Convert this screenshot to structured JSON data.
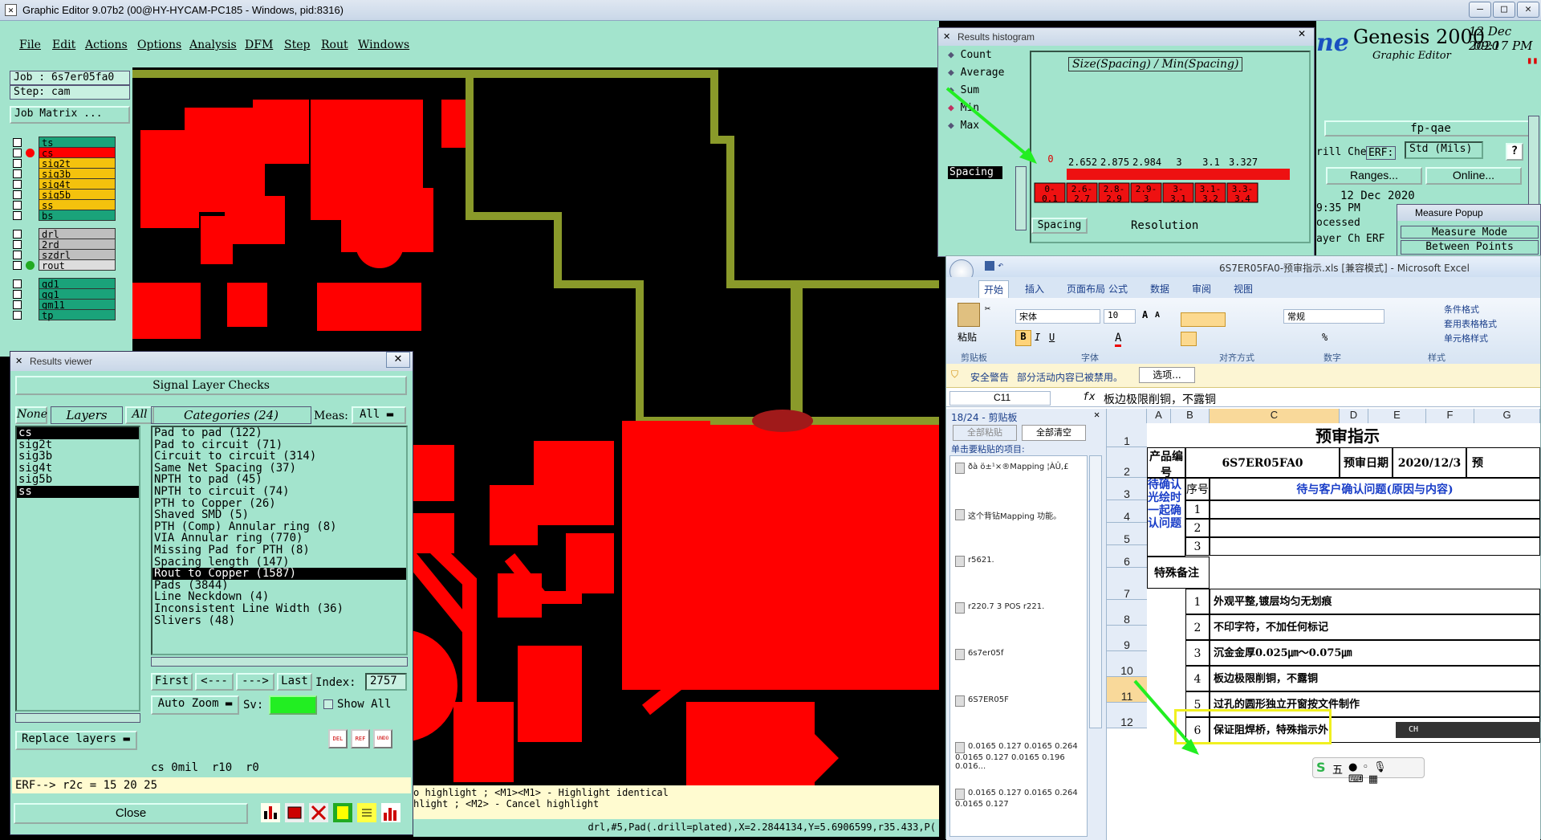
{
  "window": {
    "title": "Graphic Editor 9.07b2 (00@HY-HYCAM-PC185 - Windows, pid:8316)"
  },
  "menu": [
    "File",
    "Edit",
    "Actions",
    "Options",
    "Analysis",
    "DFM",
    "Step",
    "Rout",
    "Windows"
  ],
  "job": {
    "job_label": "Job : 6s7er05fa0",
    "step_label": "Step: cam",
    "matrix_button": "Job Matrix ..."
  },
  "layers": [
    {
      "name": "ts",
      "color": "#1aa37a",
      "dot": ""
    },
    {
      "name": "cs",
      "color": "#ff0000",
      "dot": "#ff0000"
    },
    {
      "name": "sig2t",
      "color": "#f4c20d",
      "dot": ""
    },
    {
      "name": "sig3b",
      "color": "#f4c20d",
      "dot": ""
    },
    {
      "name": "sig4t",
      "color": "#f4c20d",
      "dot": ""
    },
    {
      "name": "sig5b",
      "color": "#f4c20d",
      "dot": ""
    },
    {
      "name": "ss",
      "color": "#f4c20d",
      "dot": ""
    },
    {
      "name": "bs",
      "color": "#1aa37a",
      "dot": ""
    },
    {
      "name": "drl",
      "color": "#bfbfbf",
      "dot": ""
    },
    {
      "name": "2rd",
      "color": "#bfbfbf",
      "dot": ""
    },
    {
      "name": "szdrl",
      "color": "#bfbfbf",
      "dot": ""
    },
    {
      "name": "rout",
      "color": "#dddddd",
      "dot": "#22aa22"
    },
    {
      "name": "gd1",
      "color": "#1aa37a",
      "dot": ""
    },
    {
      "name": "gg1",
      "color": "#1aa37a",
      "dot": ""
    },
    {
      "name": "gm11",
      "color": "#1aa37a",
      "dot": ""
    },
    {
      "name": "tp",
      "color": "#1aa37a",
      "dot": ""
    }
  ],
  "results_viewer": {
    "title": "Results viewer",
    "header": "Signal Layer Checks",
    "none_btn": "None",
    "layers_label": "Layers",
    "all_btn": "All",
    "layer_list": [
      "cs",
      "sig2t",
      "sig3b",
      "sig4t",
      "sig5b",
      "ss"
    ],
    "categories_label": "Categories (24)",
    "meas_label": "Meas:",
    "meas_value": "All",
    "categories": [
      "Pad to pad (122)",
      "Pad to circuit (71)",
      "Circuit to circuit (314)",
      "Same Net Spacing (37)",
      "NPTH to pad (45)",
      "NPTH to circuit (74)",
      "PTH to Copper (26)",
      "Shaved SMD (5)",
      "PTH (Comp) Annular ring (8)",
      "VIA Annular ring (770)",
      "Missing Pad for PTH (8)",
      "Spacing length (147)",
      "Rout to Copper (1587)",
      "Pads (3844)",
      "Line Neckdown (4)",
      "Inconsistent Line Width (36)",
      "Slivers (48)"
    ],
    "selected_category": "Rout to Copper (1587)",
    "first_btn": "First",
    "prev_btn": "<---",
    "next_btn": "--->",
    "last_btn": "Last",
    "index_label": "Index:",
    "index_value": "2757",
    "auto_zoom": "Auto Zoom",
    "sv_label": "Sv:",
    "show_all": "Show All",
    "replace_layers": "Replace layers",
    "info_line": "cs 0mil  r10  r0",
    "erf_line": "ERF--> r2c = 15 20 25",
    "close_btn": "Close"
  },
  "histogram": {
    "title": "Results histogram",
    "radios": [
      "Count",
      "Average",
      "Sum",
      "Min",
      "Max"
    ],
    "selected": "Min",
    "measure_label": "Spacing",
    "chart_title": "Size(Spacing) / Min(Spacing)",
    "zero_label": "0",
    "bar_values": [
      "2.652",
      "2.875",
      "2.984",
      "3",
      "3.1",
      "3.327"
    ],
    "bins": [
      "0-\n0.1",
      "2.6-\n2.7",
      "2.8-\n2.9",
      "2.9-\n3",
      "3-\n3.1",
      "3.1-\n3.2",
      "3.3-\n3.4"
    ],
    "spacing_btn": "Spacing",
    "resolution_label": "Resolution"
  },
  "genesis": {
    "logo": "Genesis 2000",
    "sub": "Graphic Editor",
    "date": "12 Dec 2020",
    "time": "09:17 PM",
    "brand_partial": "ne"
  },
  "right_panel": {
    "fp": "fp-qae",
    "drill_check": "rill Che",
    "erf": "ERF:",
    "std": "Std (Mils)",
    "help": "?",
    "ranges": "Ranges...",
    "online": "Online...",
    "date2": "12 Dec 2020",
    "time2": "9:35 PM",
    "processed": "ocessed",
    "layer_ch": "ayer Ch",
    "erf2": "ERF"
  },
  "measure_popup": {
    "title": "Measure Popup",
    "mode": "Measure Mode",
    "between": "Between Points"
  },
  "status": {
    "line1": "o highlight ; <M1><M1> - Highlight identical",
    "line2": "hlight ; <M2> - Cancel highlight",
    "coords": "drl,#5,Pad(.drill=plated),X=2.2844134,Y=5.6906599,r35.433,P("
  },
  "excel": {
    "title": "6S7ER05FA0-预审指示.xls [兼容模式] - Microsoft Excel",
    "tabs": [
      "开始",
      "插入",
      "页面布局",
      "公式",
      "数据",
      "审阅",
      "视图"
    ],
    "font_name": "宋体",
    "font_size": "10",
    "number_format": "常规",
    "groups": [
      "剪贴板",
      "字体",
      "对齐方式",
      "数字",
      "样式"
    ],
    "paste": "粘贴",
    "styles": [
      "条件格式",
      "套用表格格式",
      "单元格样式"
    ],
    "security_label": "安全警告",
    "security_text": "部分活动内容已被禁用。",
    "options_btn": "选项...",
    "cell_ref": "C11",
    "formula": "板边极限削铜，不露铜",
    "clipboard_title": "18/24 - 剪贴板",
    "paste_all": "全部粘贴",
    "clear_all": "全部清空",
    "clip_hint": "单击要粘贴的项目:",
    "clip_items": [
      "ðà ö±¹×®Mapping ¦ÀÛ,£",
      "这个背钻Mapping 功能。",
      "r5621.",
      "r220.7 3 POS r221.",
      "6s7er05f",
      "6S7ER05F",
      "0.0165 0.127 0.0165 0.264 0.0165 0.127 0.0165 0.196 0.016...",
      "0.0165 0.127 0.0165 0.264 0.0165 0.127"
    ],
    "columns": [
      "A",
      "B",
      "C",
      "D",
      "E",
      "F",
      "G"
    ],
    "rows": [
      "1",
      "2",
      "3",
      "4",
      "5",
      "6",
      "7",
      "8",
      "9",
      "10",
      "11",
      "12"
    ],
    "sheet_title": "预审指示",
    "product_label": "产品编号",
    "product_value": "6S7ER05FA0",
    "date_label": "预审日期",
    "date_value": "2020/12/3",
    "trail": "预",
    "seq_label": "序号",
    "confirm_header": "待与客户确认问题(原因与内容)",
    "confirm_side": "待确认光绘时一起确认问题",
    "special_label": "特殊备注",
    "items": [
      {
        "n": "1",
        "t": ""
      },
      {
        "n": "2",
        "t": ""
      },
      {
        "n": "3",
        "t": ""
      }
    ],
    "remarks": [
      {
        "n": "1",
        "t": "外观平整,镀层均匀无划痕"
      },
      {
        "n": "2",
        "t": "不印字符，不加任何标记"
      },
      {
        "n": "3",
        "t": "沉金金厚0.025㎛～0.075㎛"
      },
      {
        "n": "4",
        "t": "板边极限削铜，不露铜"
      },
      {
        "n": "5",
        "t": "过孔的圆形独立开窗按文件制作"
      },
      {
        "n": "6",
        "t": "保证阻焊桥，特殊指示外"
      }
    ],
    "ime": "五",
    "ch_label": "CH"
  },
  "colors": {
    "panel": "#a3e4cd",
    "copper": "#ff0000",
    "rout": "#8a9a2a",
    "highlight": "#f0f020"
  }
}
